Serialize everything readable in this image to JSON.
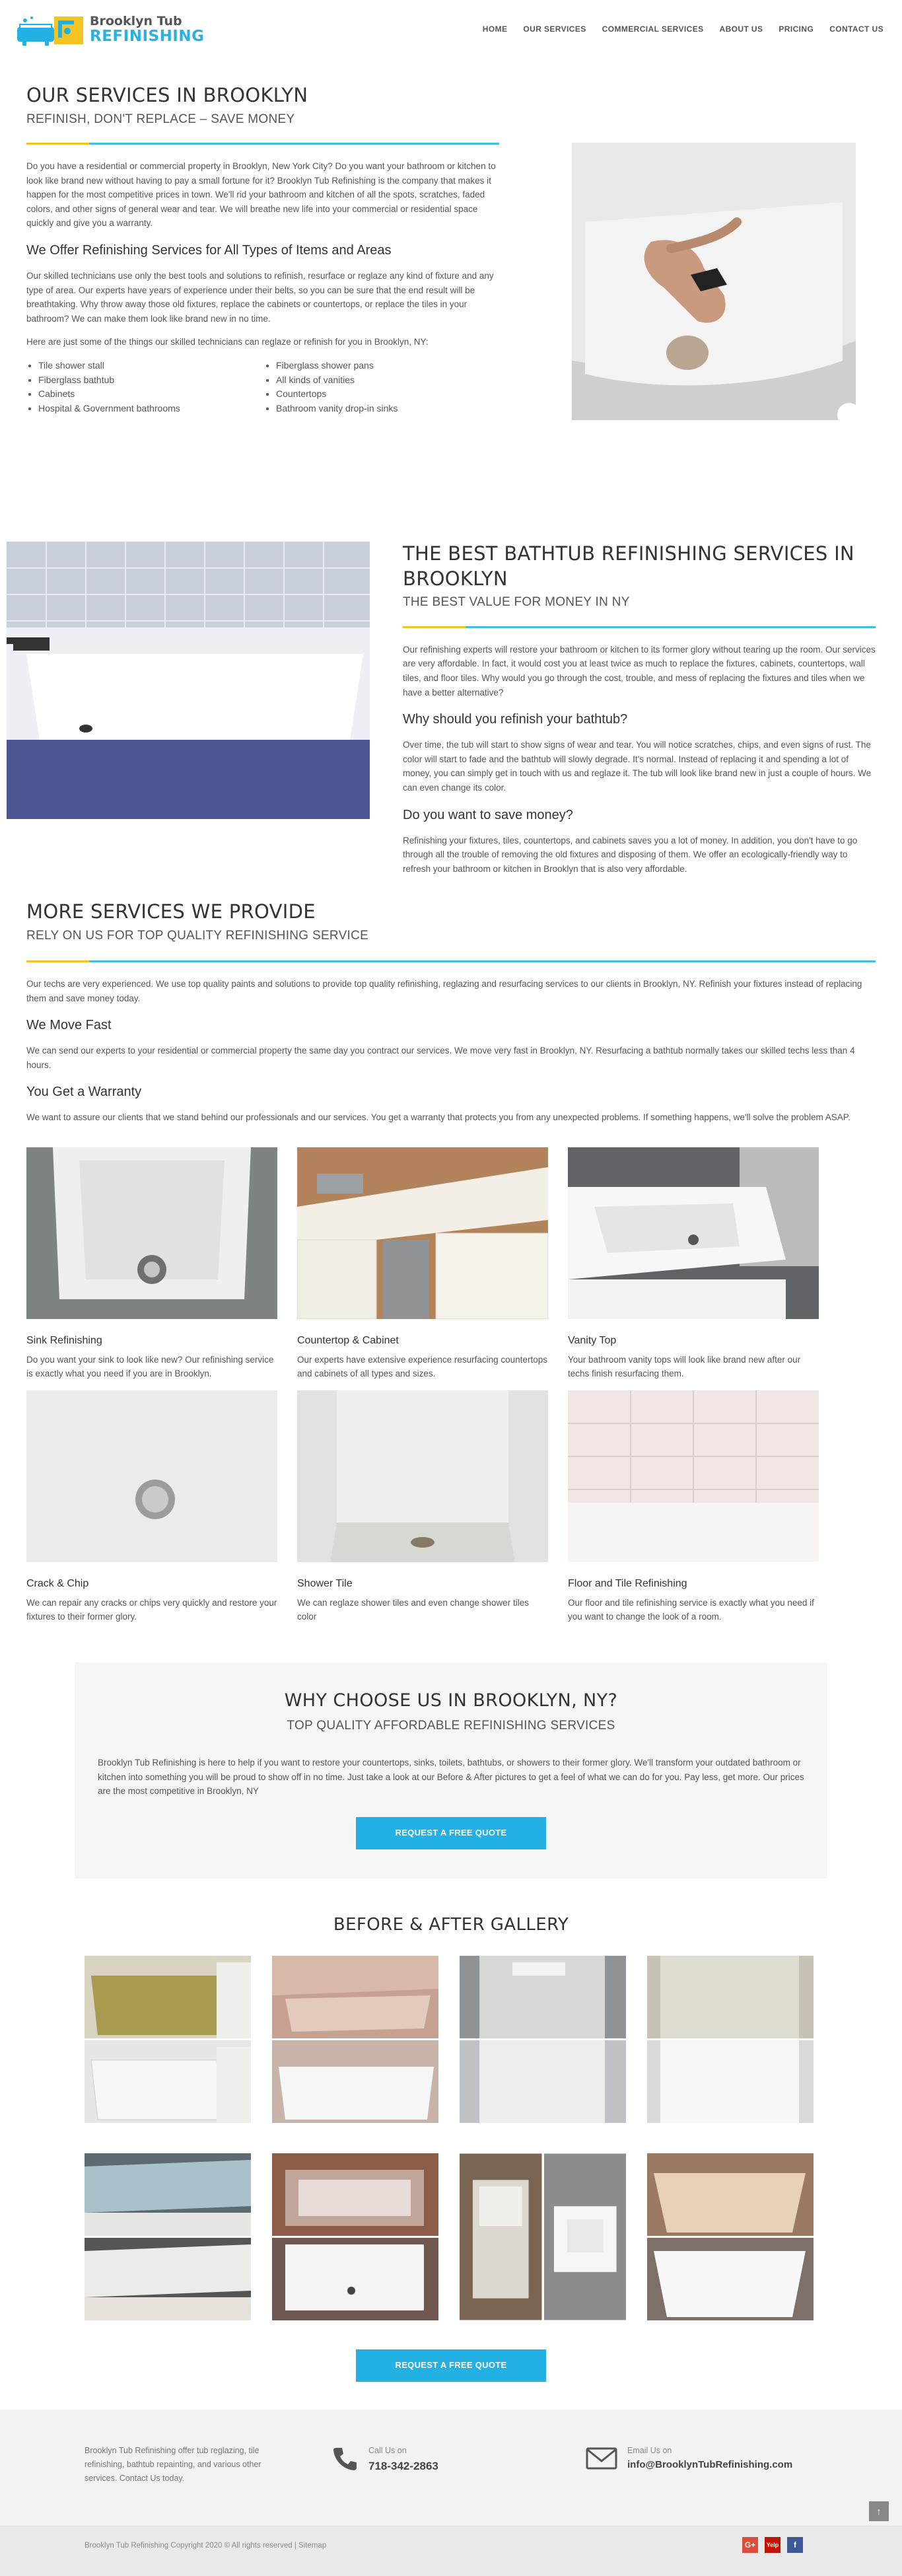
{
  "header": {
    "logo_line1": "Brooklyn Tub",
    "logo_line2": "REFINISHING",
    "nav": [
      "HOME",
      "OUR SERVICES",
      "COMMERCIAL SERVICES",
      "ABOUT US",
      "PRICING",
      "CONTACT US"
    ]
  },
  "intro": {
    "title": "OUR SERVICES IN BROOKLYN",
    "subtitle": "REFINISH, DON'T REPLACE – SAVE MONEY",
    "p1": "Do you have a residential or commercial property in Brooklyn, New York City? Do you want your bathroom or kitchen to look like brand new without having to pay a small fortune for it? Brooklyn Tub Refinishing is the company that makes it happen for the most competitive prices in town. We'll rid your bathroom and kitchen of all the spots, scratches, faded colors, and other signs of general wear and tear. We will breathe new life into your commercial or residential space quickly and give you a warranty.",
    "h2": "We Offer Refinishing Services for All Types of Items and Areas",
    "p2": "Our skilled technicians use only the best tools and solutions to refinish, resurface or reglaze any kind of fixture and any type of area. Our experts have years of experience under their belts, so you can be sure that the end result will be breathtaking. Why throw away those old fixtures, replace the cabinets or countertops, or replace the tiles in your bathroom? We can make them look like brand new in no time.",
    "p3": "Here are just some of the things our skilled technicians can reglaze or refinish for you in Brooklyn, NY:",
    "items": [
      "Tile shower stall",
      "Fiberglass shower pans",
      "Fiberglass bathtub",
      "All kinds of vanities",
      "Cabinets",
      "Countertops",
      "Hospital & Government bathrooms",
      "Bathroom vanity drop-in sinks"
    ]
  },
  "best": {
    "title": "THE BEST BATHTUB REFINISHING SERVICES IN BROOKLYN",
    "subtitle": "THE BEST VALUE FOR MONEY IN NY",
    "p1": "Our refinishing experts will restore your bathroom or kitchen to its former glory without tearing up the room. Our services are very affordable. In fact, it would cost you at least twice as much to replace the fixtures, cabinets, countertops, wall tiles, and floor tiles. Why would you go through the cost, trouble, and mess of replacing the fixtures and tiles when we have a better alternative?",
    "h2": "Why should you refinish your bathtub?",
    "p2": "Over time, the tub will start to show signs of wear and tear. You will notice scratches, chips, and even signs of rust. The color will start to fade and the bathtub will slowly degrade. It's normal. Instead of replacing it and spending a lot of money, you can simply get in touch with us and reglaze it. The tub will look like brand new in just a couple of hours. We can even change its color.",
    "h3": "Do you want to save money?",
    "p3": "Refinishing your fixtures, tiles, countertops, and cabinets saves you a lot of money. In addition, you don't have to go through all the trouble of removing the old fixtures and disposing of them. We offer an ecologically-friendly way to refresh your bathroom or kitchen in Brooklyn that is also very affordable."
  },
  "more": {
    "title": "MORE SERVICES WE PROVIDE",
    "subtitle": "RELY ON US FOR TOP QUALITY REFINISHING SERVICE",
    "p1": "Our techs are very experienced. We use top quality paints and solutions to provide top quality refinishing, reglazing and resurfacing services to our clients in Brooklyn, NY. Refinish your fixtures instead of replacing them and save money today.",
    "h2": "We Move Fast",
    "p2": "We can send our experts to your residential or commercial property the same day you contract our services. We move very fast in Brooklyn, NY. Resurfacing a bathtub normally takes our skilled techs less than 4 hours.",
    "h3": "You Get a Warranty",
    "p3": "We want to assure our clients that we stand behind our professionals and our services. You get a warranty that protects you from any unexpected problems. If something happens, we'll solve the problem ASAP.",
    "cards": [
      {
        "title": "Sink Refinishing",
        "text": "Do you want your sink to look like new? Our refinishing service is exactly what you need if you are in Brooklyn."
      },
      {
        "title": "Countertop & Cabinet",
        "text": "Our experts have extensive experience resurfacing countertops and cabinets of all types and sizes."
      },
      {
        "title": "Vanity Top",
        "text": "Your bathroom vanity tops will look like brand new after our techs finish resurfacing them."
      },
      {
        "title": "Crack & Chip",
        "text": "We can repair any cracks or chips very quickly and restore your fixtures to their former glory."
      },
      {
        "title": "Shower Tile",
        "text": "We can reglaze shower tiles and even change shower tiles color"
      },
      {
        "title": "Floor and Tile Refinishing",
        "text": "Our floor and tile refinishing service is exactly what you need if you want to change the look of a room."
      }
    ]
  },
  "why": {
    "title": "WHY CHOOSE US IN BROOKLYN, NY?",
    "subtitle": "TOP QUALITY AFFORDABLE REFINISHING SERVICES",
    "p": "Brooklyn Tub Refinishing is here to help if you want to restore your countertops, sinks, toilets, bathtubs, or showers to their former glory. We'll transform your outdated bathroom or kitchen into something you will be proud to show off in no time. Just take a look at our Before & After pictures to get a feel of what we can do for you. Pay less, get more. Our prices are the most competitive in Brooklyn, NY",
    "button": "REQUEST A FREE QUOTE"
  },
  "gallery": {
    "title": "BEFORE & AFTER GALLERY",
    "button": "REQUEST A FREE QUOTE"
  },
  "footer": {
    "about": "Brooklyn Tub Refinishing offer tub reglazing, tile refinishing, bathtub repainting, and various other services. Contact Us today.",
    "call_label": "Call Us on",
    "phone": "718-342-2863",
    "email_label": "Email Us on",
    "email": "info@BrooklynTubRefinishing.com",
    "copyright": "Brooklyn Tub Refinishing Copyright 2020 © All rights reserved | Sitemap",
    "social": [
      "G+",
      "Yelp",
      "f"
    ]
  },
  "colors": {
    "accent": "#22b1e2",
    "yellow": "#f4c522",
    "rule_blue": "#3cc0e8"
  }
}
